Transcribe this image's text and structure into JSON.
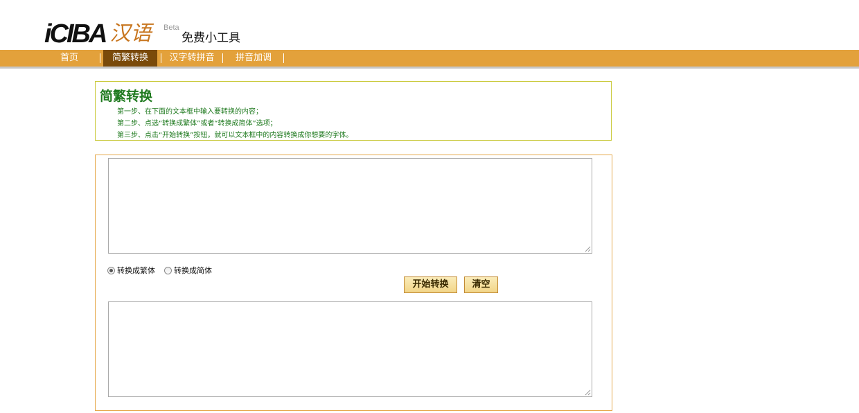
{
  "brand": {
    "logo_text": "iCIBA",
    "logo_cn": "汉语",
    "beta": "Beta",
    "tagline": "免费小工具"
  },
  "nav": {
    "items": [
      {
        "label": "首页",
        "active": false
      },
      {
        "label": "简繁转换",
        "active": true
      },
      {
        "label": "汉字转拼音",
        "active": false
      },
      {
        "label": "拼音加调",
        "active": false
      }
    ]
  },
  "instructions": {
    "title": "简繁转换",
    "steps": [
      "第一步、在下面的文本框中输入要转换的内容；",
      "第二步、点选“转换成繁体”或者“转换成简体”选项；",
      "第三步、点击“开始转换”按钮，就可以文本框中的内容转换成你想要的字体。"
    ]
  },
  "converter": {
    "input_value": "",
    "output_value": "",
    "options": [
      {
        "label": "转换成繁体",
        "checked": true
      },
      {
        "label": "转换成简体",
        "checked": false
      }
    ],
    "start_label": "开始转换",
    "clear_label": "清空"
  },
  "colors": {
    "nav_bg": "#e3a13b",
    "nav_active": "#7a4a0a",
    "instruction_text": "#1f7a1f",
    "logo_cn": "#c8761f"
  }
}
